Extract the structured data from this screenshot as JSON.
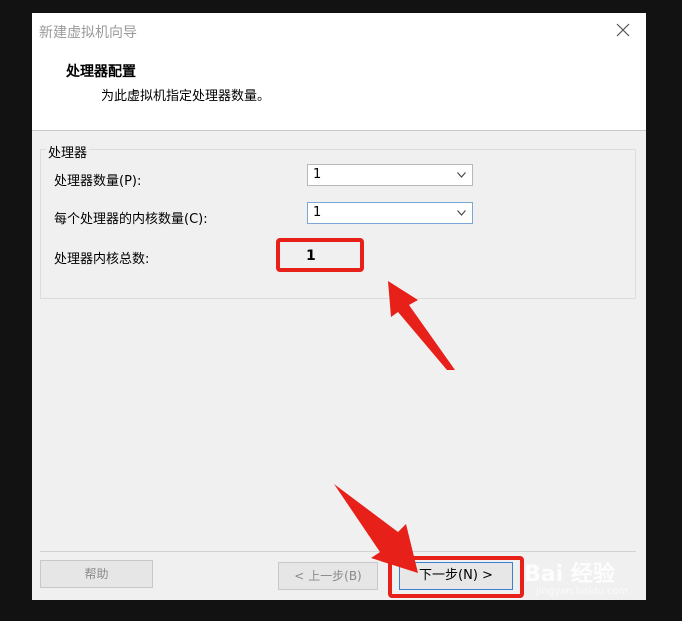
{
  "window": {
    "title": "新建虚拟机向导",
    "close_icon": "close-icon"
  },
  "header": {
    "title": "处理器配置",
    "subtitle": "为此虚拟机指定处理器数量。"
  },
  "processor_group": {
    "label": "处理器",
    "count_label": "处理器数量(P):",
    "count_value": "1",
    "cores_label": "每个处理器的内核数量(C):",
    "cores_value": "1",
    "total_label": "处理器内核总数:",
    "total_value": "1"
  },
  "footer": {
    "help_label": "帮助",
    "back_label": "< 上一步(B)",
    "next_label": "下一步(N) >"
  },
  "watermark": {
    "text": "Bai 经验",
    "url": "jingyan.baidu.com"
  },
  "colors": {
    "annotation_red": "#e8201a",
    "focus_blue": "#3c7fd0"
  }
}
